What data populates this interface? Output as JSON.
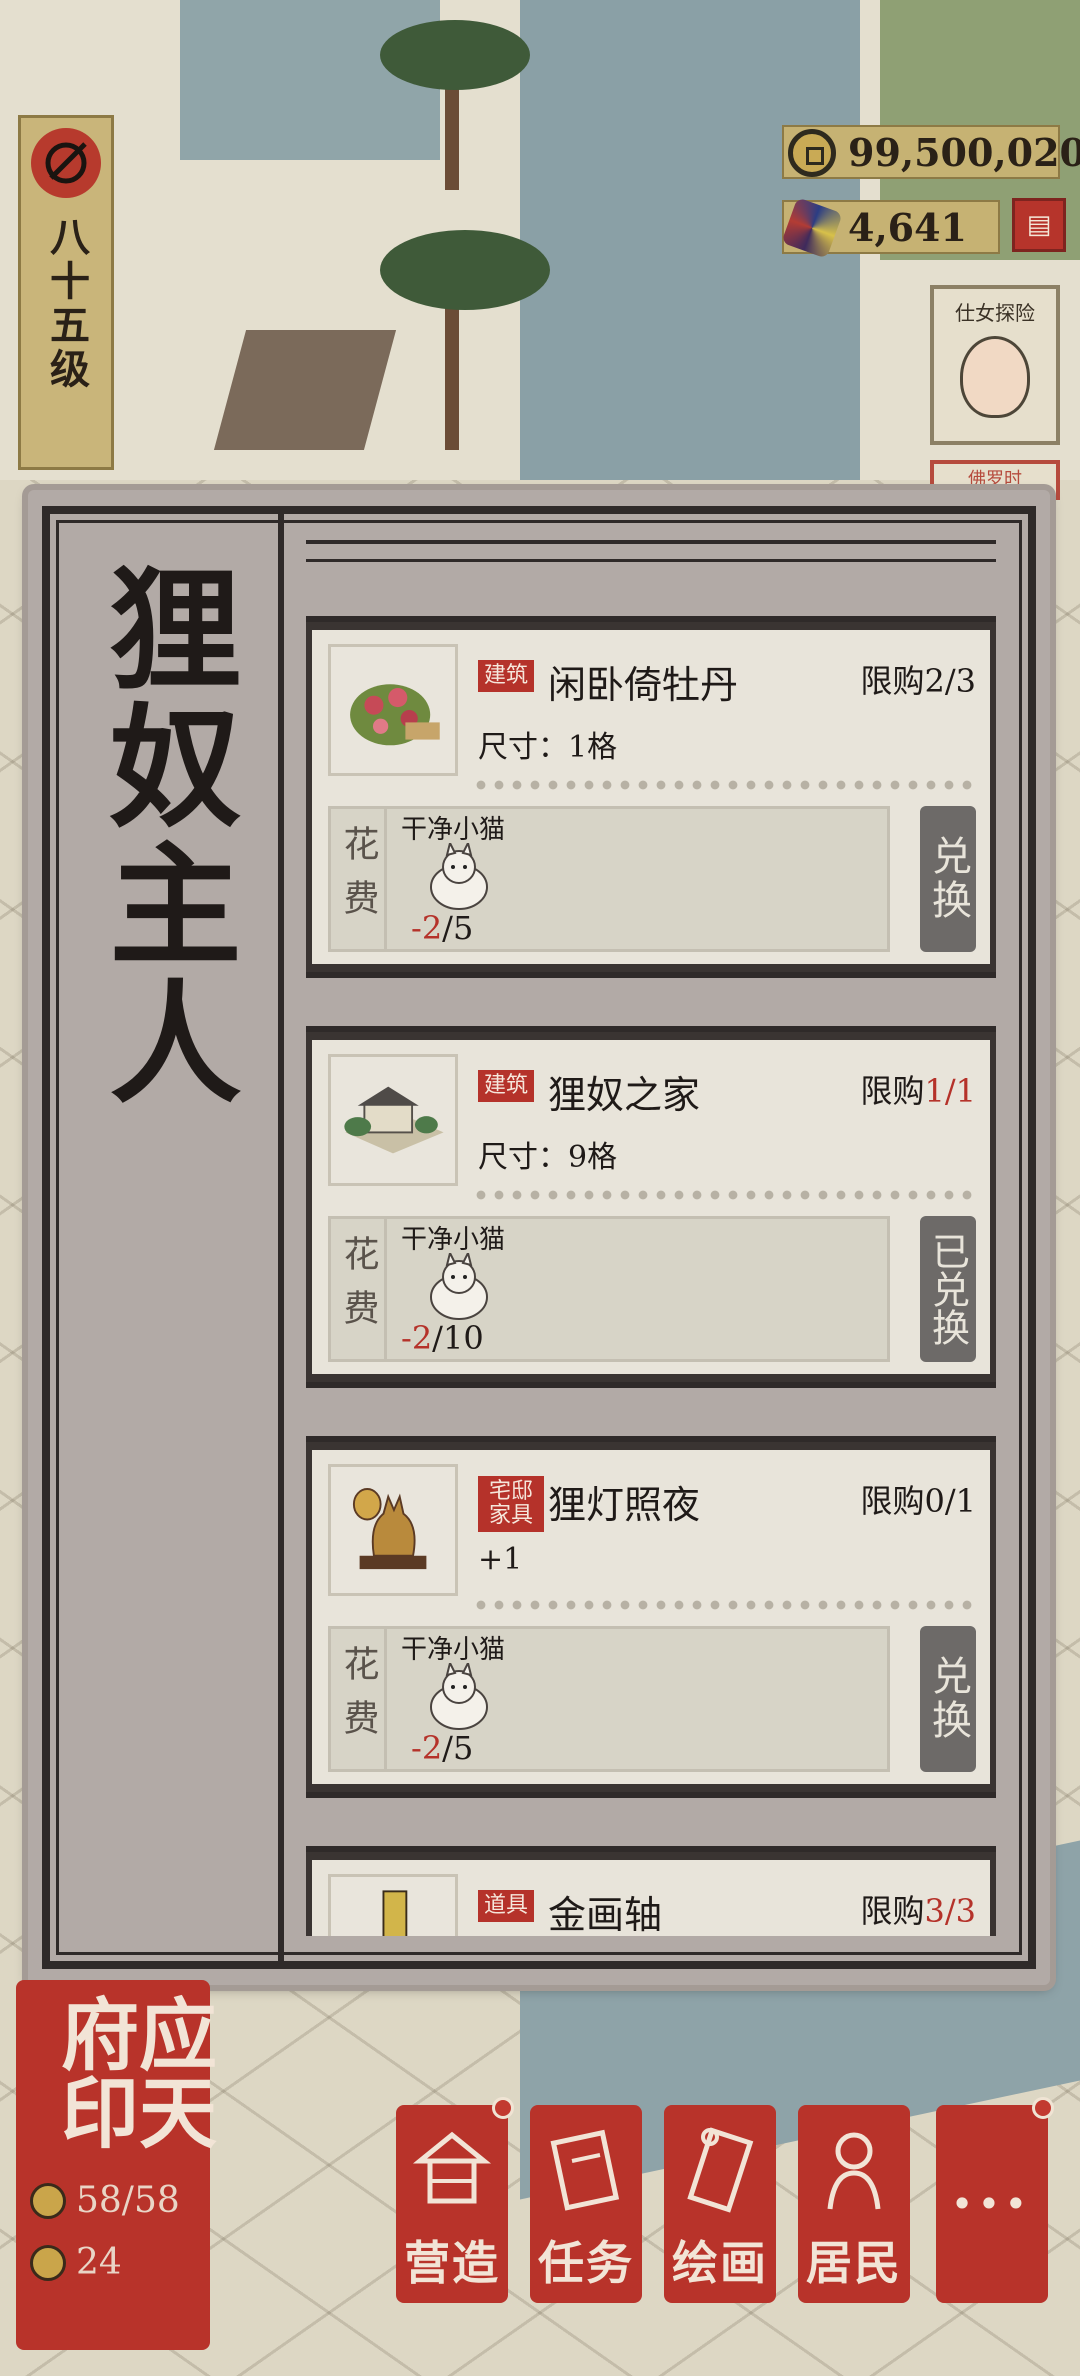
{
  "level": {
    "text": "八十五级"
  },
  "currencies": {
    "coins": "99,500,020",
    "gems": "4,641"
  },
  "side_card": {
    "title": "仕女探险",
    "sub": "佛罗时"
  },
  "panel": {
    "title": "狸奴主人"
  },
  "items": [
    {
      "tag": "建筑",
      "name": "闲卧倚牡丹",
      "limit_prefix": "限购",
      "limit_value": "2/3",
      "limit_red": false,
      "detail": "尺寸：1格",
      "cost_label": "花费",
      "material": "干净小猫",
      "cost_need": "-2",
      "cost_have": "/5",
      "button": "兑换",
      "redeemed": false
    },
    {
      "tag": "建筑",
      "name": "狸奴之家",
      "limit_prefix": "限购",
      "limit_value": "1/1",
      "limit_red": true,
      "detail": "尺寸：9格",
      "cost_label": "花费",
      "material": "干净小猫",
      "cost_need": "-2",
      "cost_have": "/10",
      "button": "已兑换",
      "redeemed": true
    },
    {
      "tag": "宅邸家具",
      "name": "狸灯照夜",
      "limit_prefix": "限购",
      "limit_value": "0/1",
      "limit_red": false,
      "detail": "+1",
      "cost_label": "花费",
      "material": "干净小猫",
      "cost_need": "-2",
      "cost_have": "/5",
      "button": "兑换",
      "redeemed": false
    },
    {
      "tag": "道具",
      "name": "金画轴",
      "limit_prefix": "限购",
      "limit_value": "3/3",
      "limit_red": true
    }
  ],
  "city": {
    "name": "应天府印",
    "population": "58/58",
    "residents": "24"
  },
  "nav": [
    {
      "label": "营造",
      "icon": "building-icon"
    },
    {
      "label": "任务",
      "icon": "book-icon"
    },
    {
      "label": "绘画",
      "icon": "scroll-icon"
    },
    {
      "label": "居民",
      "icon": "resident-icon"
    },
    {
      "label": "···",
      "icon": "more-icon"
    }
  ],
  "colors": {
    "seal_red": "#b8332a",
    "gold": "#c6b273",
    "panel": "#b2aaa6",
    "ink": "#1f1a18"
  }
}
